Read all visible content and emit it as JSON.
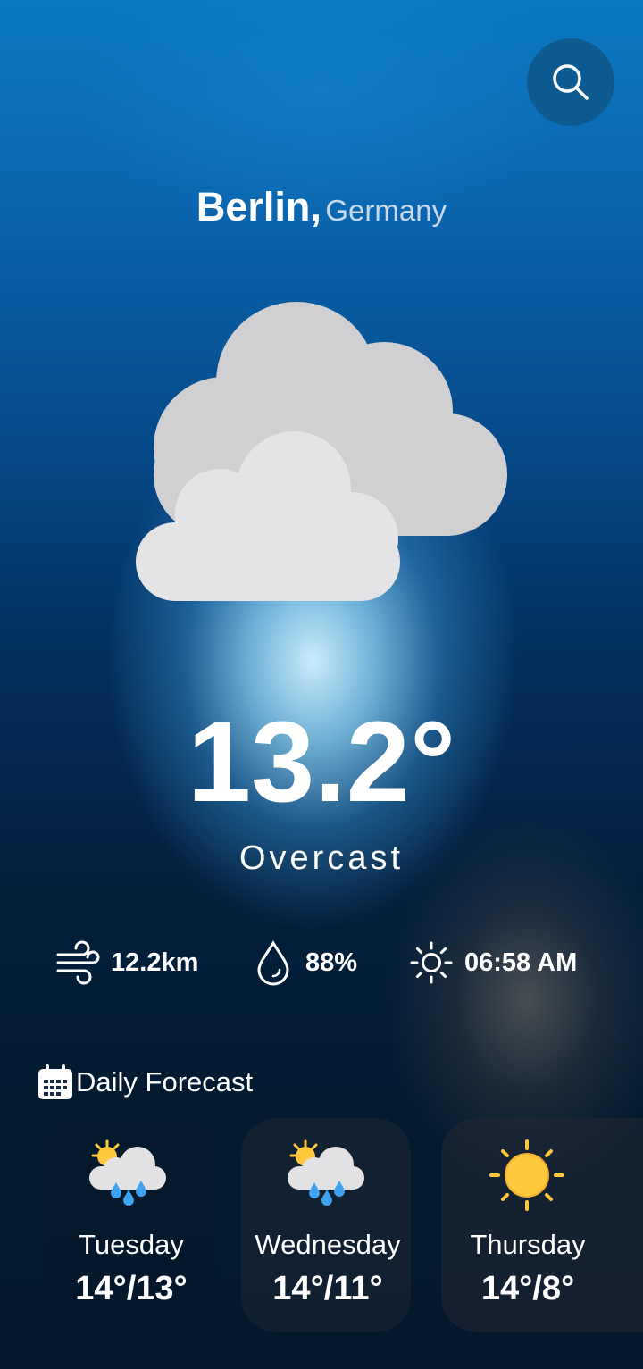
{
  "header": {
    "search_icon": "search-icon"
  },
  "location": {
    "city": "Berlin,",
    "country": "Germany"
  },
  "current": {
    "icon": "overcast-clouds-icon",
    "temperature": "13.2°",
    "condition": "Overcast"
  },
  "stats": {
    "wind": {
      "icon": "wind-icon",
      "value": "12.2km"
    },
    "humidity": {
      "icon": "water-drop-icon",
      "value": "88%"
    },
    "sunrise": {
      "icon": "sun-icon",
      "value": "06:58 AM"
    }
  },
  "forecast": {
    "icon": "calendar-icon",
    "title": "Daily Forecast",
    "days": [
      {
        "day": "Tuesday",
        "temp": "14°/13°",
        "icon": "partly-cloudy-rain-icon"
      },
      {
        "day": "Wednesday",
        "temp": "14°/11°",
        "icon": "partly-cloudy-rain-icon"
      },
      {
        "day": "Thursday",
        "temp": "14°/8°",
        "icon": "sunny-icon"
      }
    ]
  },
  "colors": {
    "background_top": "#0a78c3",
    "background_bottom": "#03182a",
    "search_button": "#0c5a90",
    "cloud_back": "#d0d0d2",
    "cloud_front": "#e4e4e6",
    "sun": "#ffc83d",
    "rain_drop": "#3fa2f0"
  }
}
